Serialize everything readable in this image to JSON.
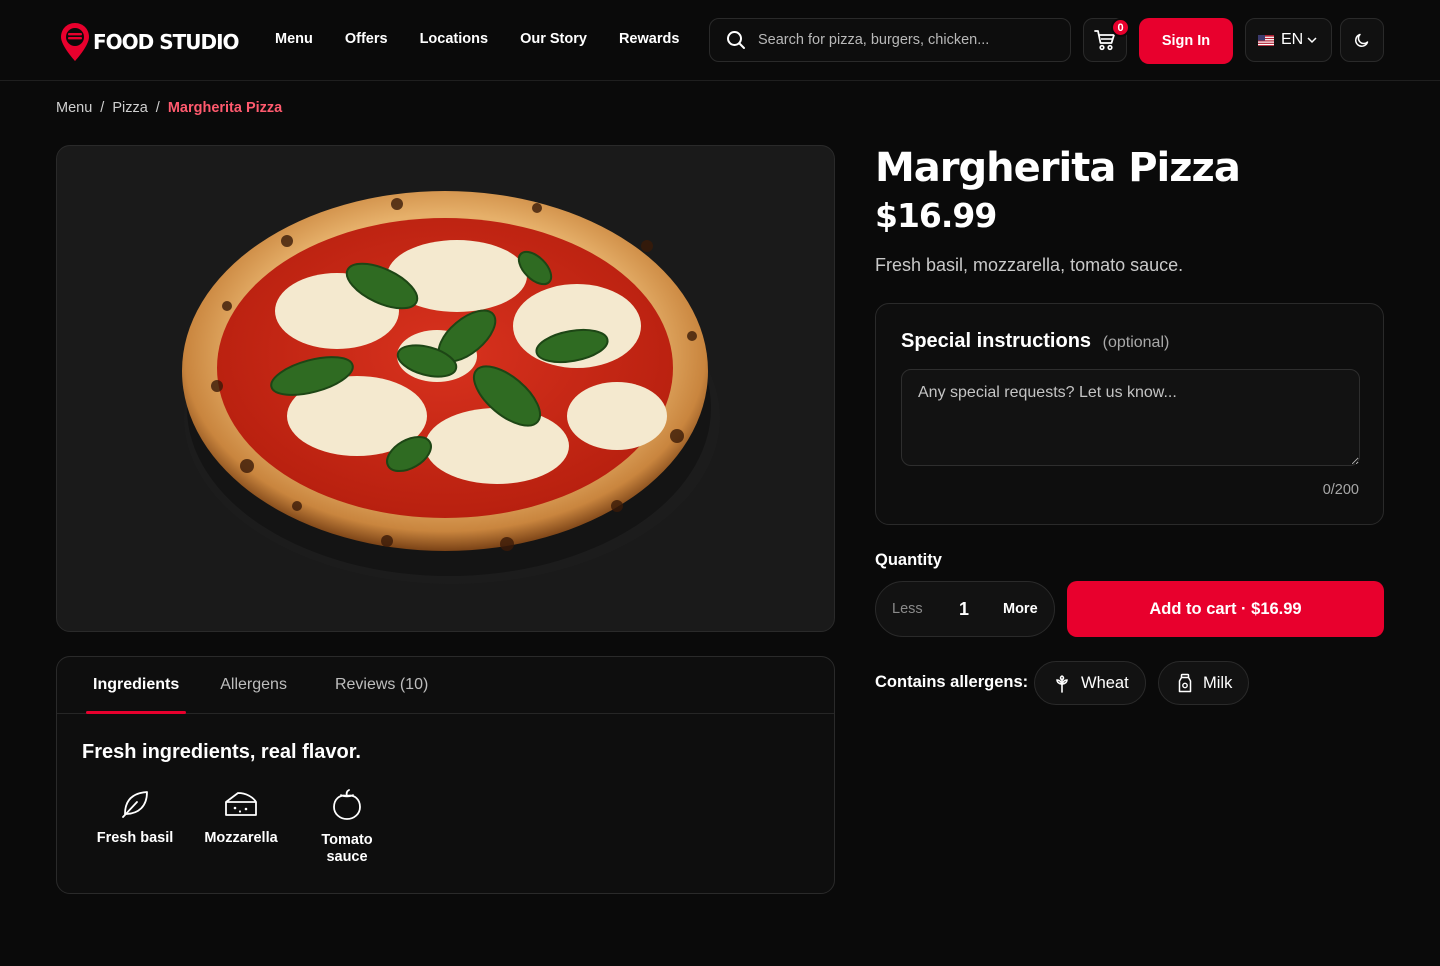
{
  "brand": {
    "name": "FOOD STUDIO",
    "accent": "#e8002d"
  },
  "nav": [
    "Menu",
    "Offers",
    "Locations",
    "Our Story",
    "Rewards"
  ],
  "search": {
    "placeholder": "Search for pizza, burgers, chicken..."
  },
  "cart": {
    "count": "0",
    "icon": "cart-icon"
  },
  "header": {
    "signin_label": "Sign In",
    "language": "EN",
    "language_flag": "us-flag-icon",
    "theme_icon": "moon-icon"
  },
  "breadcrumb": {
    "items": [
      "Menu",
      "Pizza"
    ],
    "separator": "/",
    "current": "Margherita Pizza"
  },
  "product": {
    "title": "Margherita Pizza",
    "price": "$16.99",
    "description": "Fresh basil, mozzarella, tomato sauce."
  },
  "tabs": [
    "Ingredients",
    "Allergens",
    "Reviews (10)"
  ],
  "ingredients": {
    "heading": "Fresh ingredients, real flavor.",
    "items": [
      {
        "label": "Fresh basil",
        "icon": "leaf-icon"
      },
      {
        "label": "Mozzarella",
        "icon": "cheese-icon"
      },
      {
        "label": "Tomato sauce",
        "icon": "tomato-icon"
      }
    ]
  },
  "instructions": {
    "title": "Special instructions",
    "optional": "(optional)",
    "placeholder": "Any special requests? Let us know...",
    "counter": "0/200"
  },
  "quantity": {
    "label": "Quantity",
    "less": "Less",
    "value": "1",
    "more": "More"
  },
  "add_to_cart": "Add to cart · $16.99",
  "allergens": {
    "label": "Contains allergens:",
    "items": [
      {
        "label": "Wheat",
        "icon": "wheat-icon"
      },
      {
        "label": "Milk",
        "icon": "milk-icon"
      }
    ]
  }
}
